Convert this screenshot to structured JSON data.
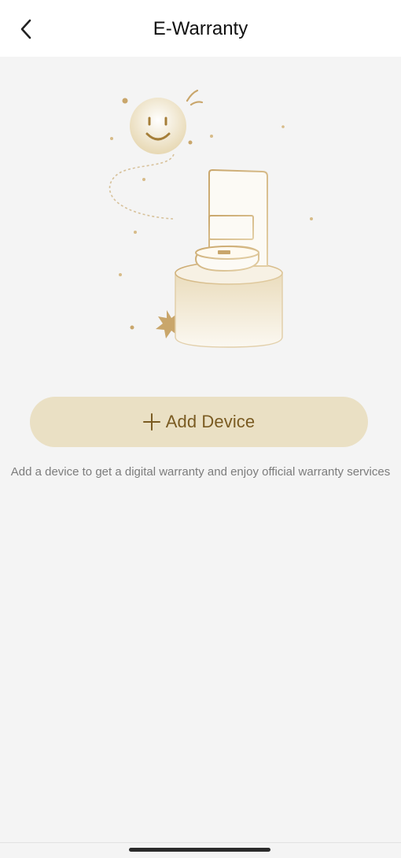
{
  "header": {
    "title": "E-Warranty",
    "back_icon": "chevron-left-icon"
  },
  "illustration": {
    "description_icon": "robot-vacuum-station-illustration",
    "accent_color": "#c9a66b"
  },
  "action": {
    "add_label": "Add Device",
    "add_icon": "plus-icon",
    "button_color": "#eae0c4",
    "text_color": "#7a5b22"
  },
  "message": {
    "text": "Add a device to get a digital warranty and enjoy official warranty services"
  }
}
